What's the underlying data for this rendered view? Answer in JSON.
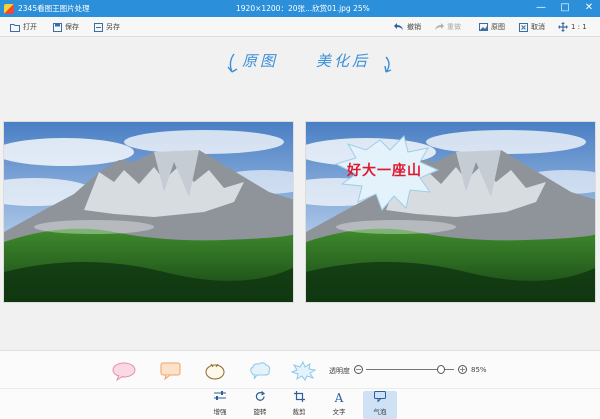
{
  "titlebar": {
    "app_title": "2345看图王图片处理",
    "file_info": "1920×1200：20张...欣赏01.jpg   25%",
    "min_glyph": "—",
    "max_glyph": "□",
    "close_glyph": "✕"
  },
  "toolbar": {
    "open": "打开",
    "save": "保存",
    "save_as": "另存",
    "undo": "撤销",
    "redo": "重做",
    "original": "原图",
    "cancel": "取消",
    "ratio": "1 : 1"
  },
  "canvas": {
    "annotation_original": "原图",
    "annotation_beautified": "美化后",
    "bubble_text": "好大一座山"
  },
  "bottom": {
    "opacity_label": "透明度",
    "opacity_value": "85%",
    "opacity_fraction": 0.85,
    "tools": {
      "enhance": "增强",
      "rotate": "旋转",
      "crop": "裁剪",
      "text": "文字",
      "bubble": "气泡"
    }
  },
  "colors": {
    "titlebar": "#2b8fd9",
    "accent": "#3c8fd6",
    "bubble_text": "#e0182e"
  }
}
